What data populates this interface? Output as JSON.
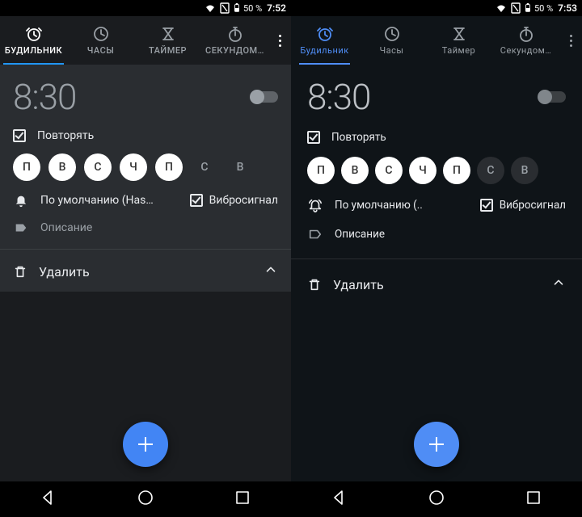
{
  "left": {
    "status": {
      "battery_pct": "50 %",
      "clock": "7:52"
    },
    "tabs": {
      "alarm": "БУДИЛЬНИК",
      "clock": "ЧАСЫ",
      "timer": "ТАЙМЕР",
      "stopwatch": "СЕКУНДОМ…"
    },
    "alarm": {
      "time": "8:30",
      "repeat_label": "Повторять",
      "days": [
        "П",
        "В",
        "С",
        "Ч",
        "П",
        "С",
        "В"
      ],
      "days_on": [
        true,
        true,
        true,
        true,
        true,
        false,
        false
      ],
      "ringtone_label": "По умолчанию (Has…",
      "vibrate_label": "Вибросигнал",
      "label_placeholder": "Описание",
      "delete_label": "Удалить"
    }
  },
  "right": {
    "status": {
      "battery_pct": "50 %",
      "clock": "7:53"
    },
    "tabs": {
      "alarm": "Будильник",
      "clock": "Часы",
      "timer": "Таймер",
      "stopwatch": "Секундом…"
    },
    "alarm": {
      "time": "8:30",
      "repeat_label": "Повторять",
      "days": [
        "П",
        "В",
        "С",
        "Ч",
        "П",
        "С",
        "В"
      ],
      "days_on": [
        true,
        true,
        true,
        true,
        true,
        false,
        false
      ],
      "ringtone_label": "По умолчанию (..",
      "vibrate_label": "Вибросигнал",
      "label_placeholder": "Описание",
      "delete_label": "Удалить"
    }
  }
}
